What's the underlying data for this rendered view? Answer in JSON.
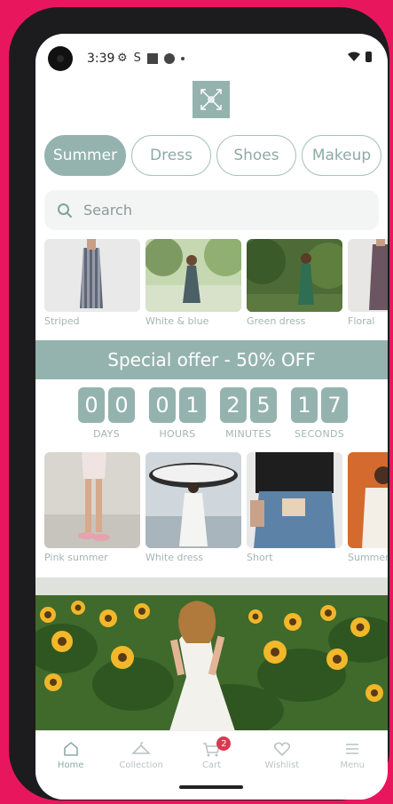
{
  "status": {
    "time": "3:39"
  },
  "categories": [
    {
      "label": "Summer",
      "active": true
    },
    {
      "label": "Dress",
      "active": false
    },
    {
      "label": "Shoes",
      "active": false
    },
    {
      "label": "Makeup",
      "active": false
    }
  ],
  "search": {
    "placeholder": "Search"
  },
  "products_row1": [
    "Striped",
    "White & blue",
    "Green dress",
    "Floral"
  ],
  "offer": {
    "text": "Special offer - 50% OFF"
  },
  "countdown": {
    "days": [
      "0",
      "0"
    ],
    "hours": [
      "0",
      "1"
    ],
    "minutes": [
      "2",
      "5"
    ],
    "seconds": [
      "1",
      "7"
    ],
    "labels": {
      "days": "DAYS",
      "hours": "HOURS",
      "minutes": "MINUTES",
      "seconds": "SECONDS"
    }
  },
  "products_row2": [
    "Pink summer",
    "White dress",
    "Short",
    "Summer"
  ],
  "nav": {
    "home": "Home",
    "collection": "Collection",
    "cart": "Cart",
    "cart_count": "2",
    "wishlist": "Wishlist",
    "menu": "Menu"
  },
  "colors": {
    "accent": "#94b3ae",
    "frame": "#e8175d",
    "badge": "#d9394f"
  }
}
